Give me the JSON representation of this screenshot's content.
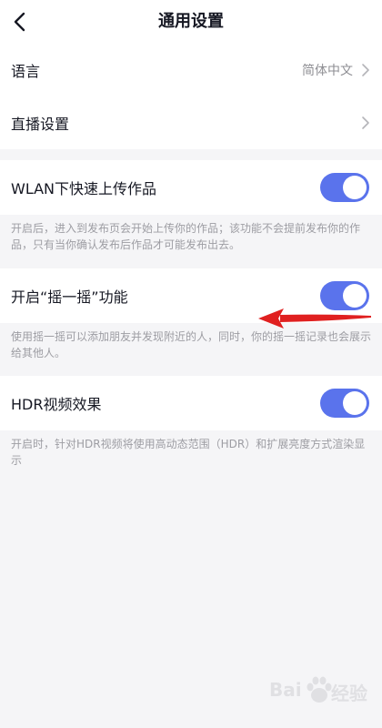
{
  "header": {
    "title": "通用设置",
    "back_icon": "chevron-left-icon"
  },
  "settings": {
    "language": {
      "label": "语言",
      "value": "简体中文"
    },
    "live": {
      "label": "直播设置"
    },
    "wlan_upload": {
      "label": "WLAN下快速上传作品",
      "enabled": true,
      "description": "开启后，进入到发布页会开始上传你的作品；该功能不会提前发布你的作品，只有当你确认发布后作品才可能发布出去。"
    },
    "shake": {
      "label": "开启“摇一摇”功能",
      "enabled": true,
      "description": "使用摇一摇可以添加朋友并发现附近的人，同时，你的摇一摇记录也会展示给其他人。"
    },
    "hdr": {
      "label": "HDR视频效果",
      "enabled": true,
      "description": "开启时，针对HDR视频将使用高动态范围（HDR）和扩展亮度方式渲染显示"
    }
  },
  "colors": {
    "toggle_on": "#5a73ec",
    "annotation_arrow": "#e02020"
  },
  "watermark": {
    "text_left": "Bai",
    "text_right": "经验",
    "icon": "paw-icon"
  }
}
